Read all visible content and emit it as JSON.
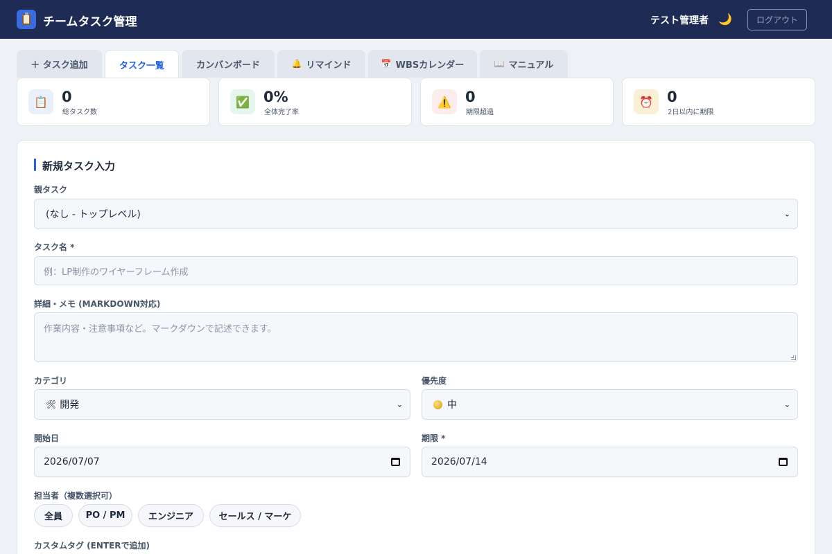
{
  "header": {
    "app_title": "チームタスク管理",
    "user_name": "テスト管理者",
    "logout_label": "ログアウト"
  },
  "tabs": [
    {
      "label": "＋ タスク追加",
      "icon": "plus-icon"
    },
    {
      "label": "タスク一覧",
      "icon": null,
      "active": true
    },
    {
      "label": "カンバンボード",
      "icon": null
    },
    {
      "label": "リマインド",
      "icon": "bell-icon"
    },
    {
      "label": "WBSカレンダー",
      "icon": "calendar-icon"
    },
    {
      "label": "マニュアル",
      "icon": "book-icon"
    }
  ],
  "stats": [
    {
      "value": "0",
      "label": "総タスク数",
      "icon": "clipboard-icon",
      "color": "#eaf0fb"
    },
    {
      "value": "0%",
      "label": "全体完了率",
      "icon": "check-icon",
      "color": "#e5f6ec"
    },
    {
      "value": "0",
      "label": "期限超過",
      "icon": "warning-icon",
      "color": "#fdecec"
    },
    {
      "value": "0",
      "label": "2日以内に期限",
      "icon": "alarm-clock-icon",
      "color": "#fbf0d6"
    }
  ],
  "form": {
    "title": "新規タスク入力",
    "parent_task_label": "親タスク",
    "parent_task_value": "(なし - トップレベル)",
    "task_name_label": "タスク名 *",
    "task_name_placeholder": "例：LP制作のワイヤーフレーム作成",
    "details_label": "詳細・メモ (MARKDOWN対応)",
    "details_placeholder": "作業内容・注意事項など。マークダウンで記述できます。",
    "category_label": "カテゴリ",
    "category_value": "開発",
    "priority_label": "優先度",
    "priority_value": "中",
    "start_date_label": "開始日",
    "start_date_value": "2026/07/07",
    "due_date_label": "期限 *",
    "due_date_value": "2026/07/14",
    "assignee_label": "担当者（複数選択可）",
    "assignees": [
      "全員",
      "PO / PM",
      "エンジニア",
      "セールス / マーケ"
    ],
    "custom_tag_label": "カスタムタグ (ENTERで追加)"
  },
  "colors": {
    "header_bg": "#1e2b55",
    "accent": "#2563eb",
    "page_bg": "#eef1f6"
  }
}
